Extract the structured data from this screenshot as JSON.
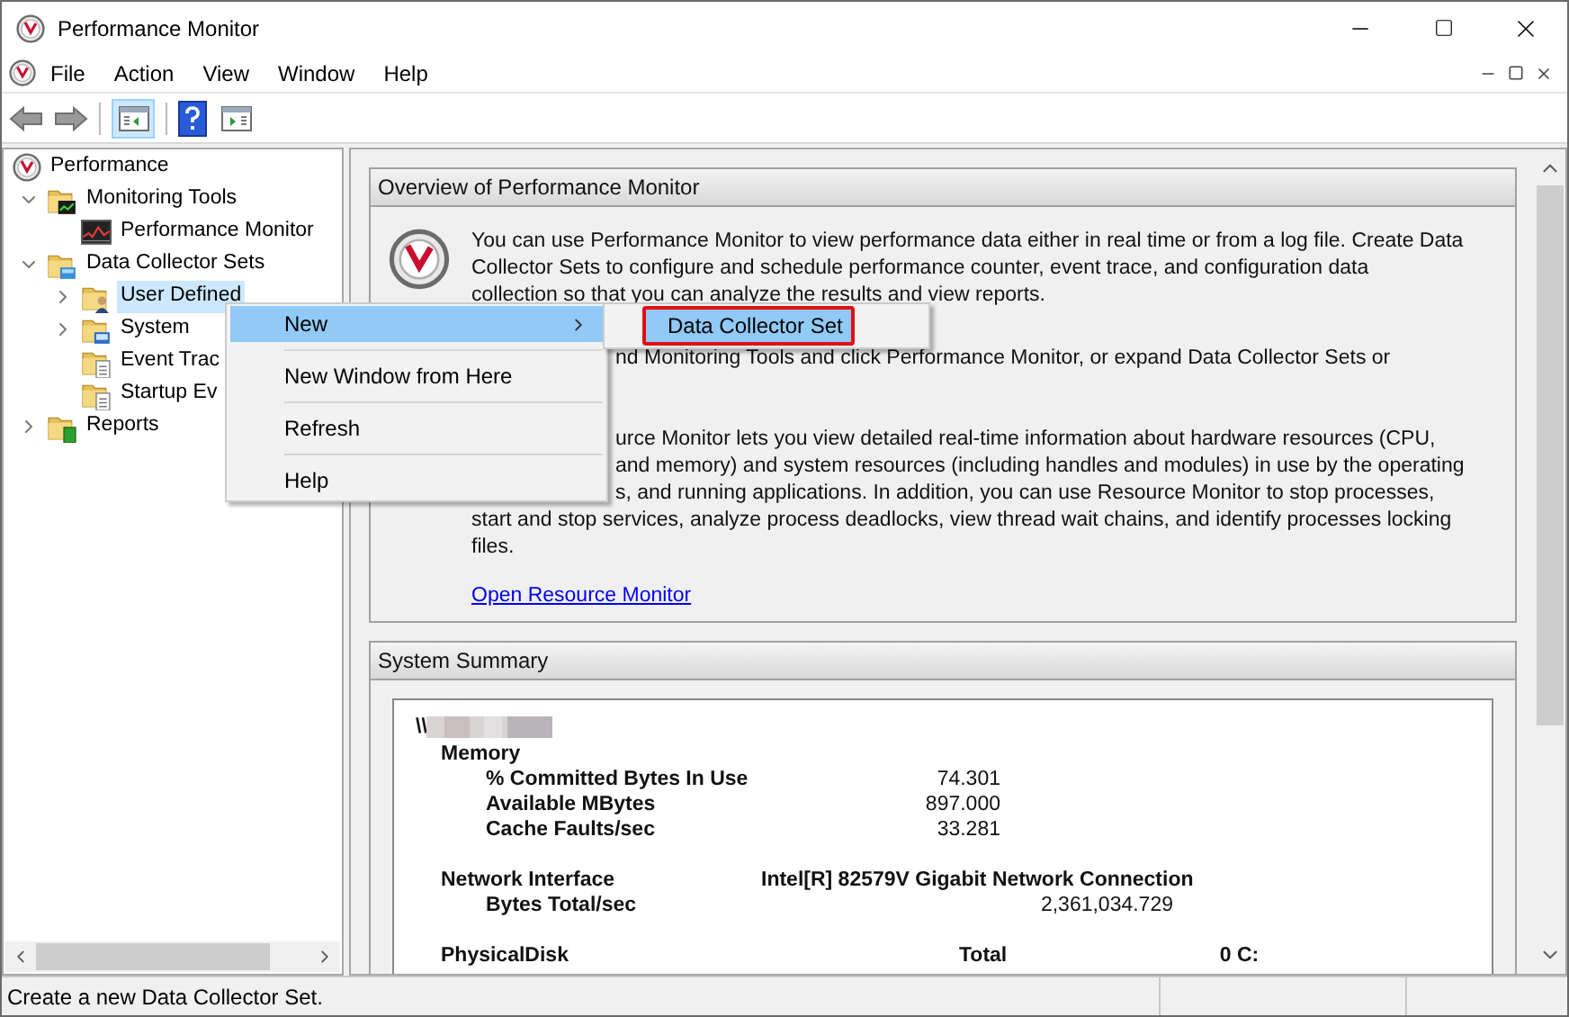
{
  "window": {
    "title": "Performance Monitor"
  },
  "menu_bar": [
    "File",
    "Action",
    "View",
    "Window",
    "Help"
  ],
  "tree": [
    {
      "label": "Performance",
      "kind": "gauge",
      "selected": false,
      "children": [
        {
          "label": "Monitoring Tools",
          "kind": "folder-chart",
          "expanded": true,
          "selected": false,
          "children": [
            {
              "label": "Performance Monitor",
              "kind": "chart",
              "selected": false
            }
          ]
        },
        {
          "label": "Data Collector Sets",
          "kind": "folder-db",
          "expanded": true,
          "selected": false,
          "children": [
            {
              "label": "User Defined",
              "kind": "folder-user",
              "expanded": false,
              "selected": true
            },
            {
              "label": "System",
              "kind": "folder-system",
              "expanded": false,
              "selected": false
            },
            {
              "label": "Event Trac",
              "kind": "folder-doc",
              "selected": false
            },
            {
              "label": "Startup Ev",
              "kind": "folder-doc",
              "selected": false
            }
          ]
        },
        {
          "label": "Reports",
          "kind": "folder-report",
          "expanded": false,
          "selected": false
        }
      ]
    }
  ],
  "context_menu": [
    {
      "label": "New",
      "submenu": true,
      "selected": true
    },
    {
      "label": "New Window from Here",
      "submenu": false,
      "selected": false
    },
    {
      "label": "Refresh",
      "submenu": false,
      "selected": false
    },
    {
      "label": "Help",
      "submenu": false,
      "selected": false
    }
  ],
  "submenu": [
    {
      "label": "Data Collector Set",
      "selected": true,
      "outlined": true
    }
  ],
  "overview": {
    "title": "Overview of Performance Monitor",
    "lines": [
      {
        "kind": "full",
        "text": "You can use Performance Monitor to view performance data either in real time or from a log file. Create Data"
      },
      {
        "kind": "full",
        "text": "Collector Sets to configure and schedule performance counter, event trace, and configuration data"
      },
      {
        "kind": "full",
        "text": "collection so that you can analyze the results and view reports."
      },
      {
        "kind": "gap"
      },
      {
        "kind": "clipped",
        "text": "nd Monitoring Tools and click Performance Monitor, or expand Data Collector Sets or"
      },
      {
        "kind": "gap"
      },
      {
        "kind": "gap"
      },
      {
        "kind": "clipped",
        "text": "urce Monitor lets you view detailed real-time information about hardware resources (CPU,"
      },
      {
        "kind": "clipped",
        "text": "and memory) and system resources (including handles and modules) in use by the operating"
      },
      {
        "kind": "clipped",
        "text": "s, and running applications. In addition, you can use Resource Monitor to stop processes,"
      },
      {
        "kind": "full",
        "text": "start and stop services, analyze process deadlocks, view thread wait chains, and identify processes locking"
      },
      {
        "kind": "full",
        "text": "files."
      }
    ],
    "link": "Open Resource Monitor"
  },
  "summary": {
    "title": "System Summary",
    "rows": [
      {
        "kind": "host",
        "label": "\\\\"
      },
      {
        "kind": "group",
        "label": "Memory"
      },
      {
        "kind": "counter",
        "label": "% Committed Bytes In Use",
        "value": "74.301"
      },
      {
        "kind": "counter",
        "label": "Available MBytes",
        "value": "897.000"
      },
      {
        "kind": "counter",
        "label": "Cache Faults/sec",
        "value": "33.281"
      },
      {
        "kind": "group",
        "label": "Network Interface",
        "value": "Intel[R] 82579V Gigabit Network Connection"
      },
      {
        "kind": "counter",
        "label": "Bytes Total/sec",
        "value": "2,361,034.729"
      },
      {
        "kind": "group",
        "label": "PhysicalDisk",
        "value": "Total",
        "value_2": "0 C:"
      }
    ]
  },
  "status_bar": "Create a new Data Collector Set."
}
